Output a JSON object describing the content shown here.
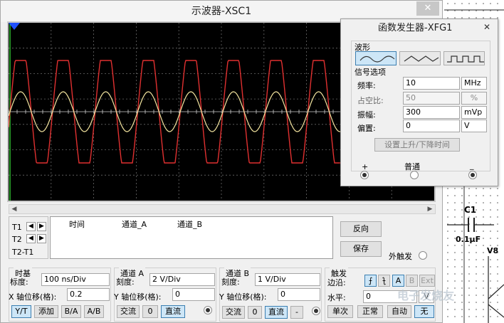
{
  "oscilloscope": {
    "title": "示波器-XSC1",
    "close_icon": "close-icon",
    "channel_a_color": "#e03030",
    "channel_b_color": "#f5e6a0",
    "cursors": {
      "t1": "T1",
      "t2": "T2",
      "t2t1": "T2-T1"
    },
    "measure_headers": [
      "时间",
      "通道_A",
      "通道_B"
    ],
    "reverse_label": "反向",
    "save_label": "保存",
    "ext_trigger_label": "外触发",
    "timebase": {
      "title": "时基",
      "scale_label": "标度:",
      "scale_value": "100 ns/Div",
      "xpos_label": "X 轴位移(格):",
      "xpos_value": "0.2",
      "buttons": [
        "Y/T",
        "添加",
        "B/A",
        "A/B"
      ]
    },
    "channel_a": {
      "title": "通道 A",
      "scale_label": "刻度:",
      "scale_value": "2  V/Div",
      "ypos_label": "Y 轴位移(格):",
      "ypos_value": "0",
      "coupling": [
        "交流",
        "0",
        "直流"
      ]
    },
    "channel_b": {
      "title": "通道 B",
      "scale_label": "刻度:",
      "scale_value": "1  V/Div",
      "ypos_label": "Y 轴位移(格):",
      "ypos_value": "0",
      "coupling": [
        "交流",
        "0",
        "直流",
        "-"
      ]
    },
    "trigger": {
      "title": "触发",
      "edge_label": "边沿:",
      "edge_buttons": [
        "⨍",
        "⨍",
        "A",
        "B",
        "Ext"
      ],
      "level_label": "水平:",
      "level_value": "0",
      "level_unit": "V",
      "mode_buttons": [
        "单次",
        "正常",
        "自动",
        "无"
      ]
    }
  },
  "function_generator": {
    "title": "函数发生器-XFG1",
    "close_icon": "close-icon",
    "waveform_label": "波形",
    "waveforms": [
      "sine-wave-icon",
      "triangle-wave-icon",
      "square-wave-icon"
    ],
    "signal_options_label": "信号选项",
    "frequency_label": "频率:",
    "frequency_value": "10",
    "frequency_unit": "MHz",
    "duty_label": "占空比:",
    "duty_value": "50",
    "duty_unit": "%",
    "amplitude_label": "振幅:",
    "amplitude_value": "300",
    "amplitude_unit": "mVp",
    "offset_label": "偏置:",
    "offset_value": "0",
    "offset_unit": "V",
    "rise_fall_button": "设置上升/下降时间",
    "plus_label": "+",
    "common_label": "普通",
    "minus_label": "_"
  },
  "schematic": {
    "capacitor_label": "C1",
    "capacitor_value": "0.1µF",
    "node_label": "V8"
  },
  "watermark": "电子发烧友"
}
